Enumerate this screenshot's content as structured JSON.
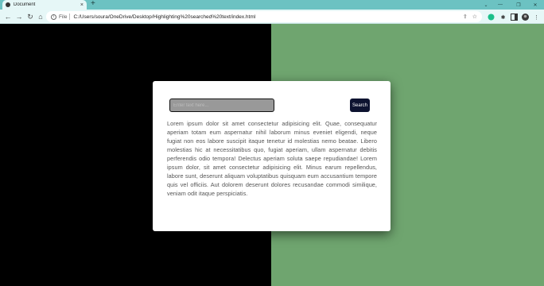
{
  "browser": {
    "tab_title": "Document",
    "tab_close": "×",
    "new_tab": "+",
    "scheme": "File",
    "url": "C:/Users/soura/OneDrive/Desktop/Highlighting%20searched%20text/index.html"
  },
  "icons": {
    "back": "back-arrow-icon",
    "forward": "forward-arrow-icon",
    "reload": "reload-icon",
    "home": "home-icon",
    "share": "share-icon",
    "bookmark": "star-icon",
    "extensions": "puzzle-icon",
    "sidepanel": "sidepanel-icon",
    "menu": "kebab-menu-icon"
  },
  "colors": {
    "left_panel": "#000000",
    "right_panel": "#6fa56f",
    "button": "#0d1330",
    "tabbar": "#6cc2c2"
  },
  "search": {
    "placeholder": "Enter text here...",
    "value": "",
    "button_label": "Search"
  },
  "content": {
    "paragraph": "Lorem ipsum dolor sit amet consectetur adipisicing elit. Quae, consequatur aperiam totam eum aspernatur nihil laborum minus eveniet eligendi, neque fugiat non eos labore suscipit itaque tenetur id molestias nemo beatae. Libero molestias hic at necessitatibus quo, fugiat aperiam, ullam aspernatur debitis perferendis odio tempora! Delectus aperiam soluta saepe repudiandae! Lorem ipsum dolor, sit amet consectetur adipisicing elit. Minus earum repellendus, labore sunt, deserunt aliquam voluptatibus quisquam eum accusantium tempore quis vel officiis. Aut dolorem deserunt dolores recusandae commodi similique, veniam odit itaque perspiciatis."
  }
}
